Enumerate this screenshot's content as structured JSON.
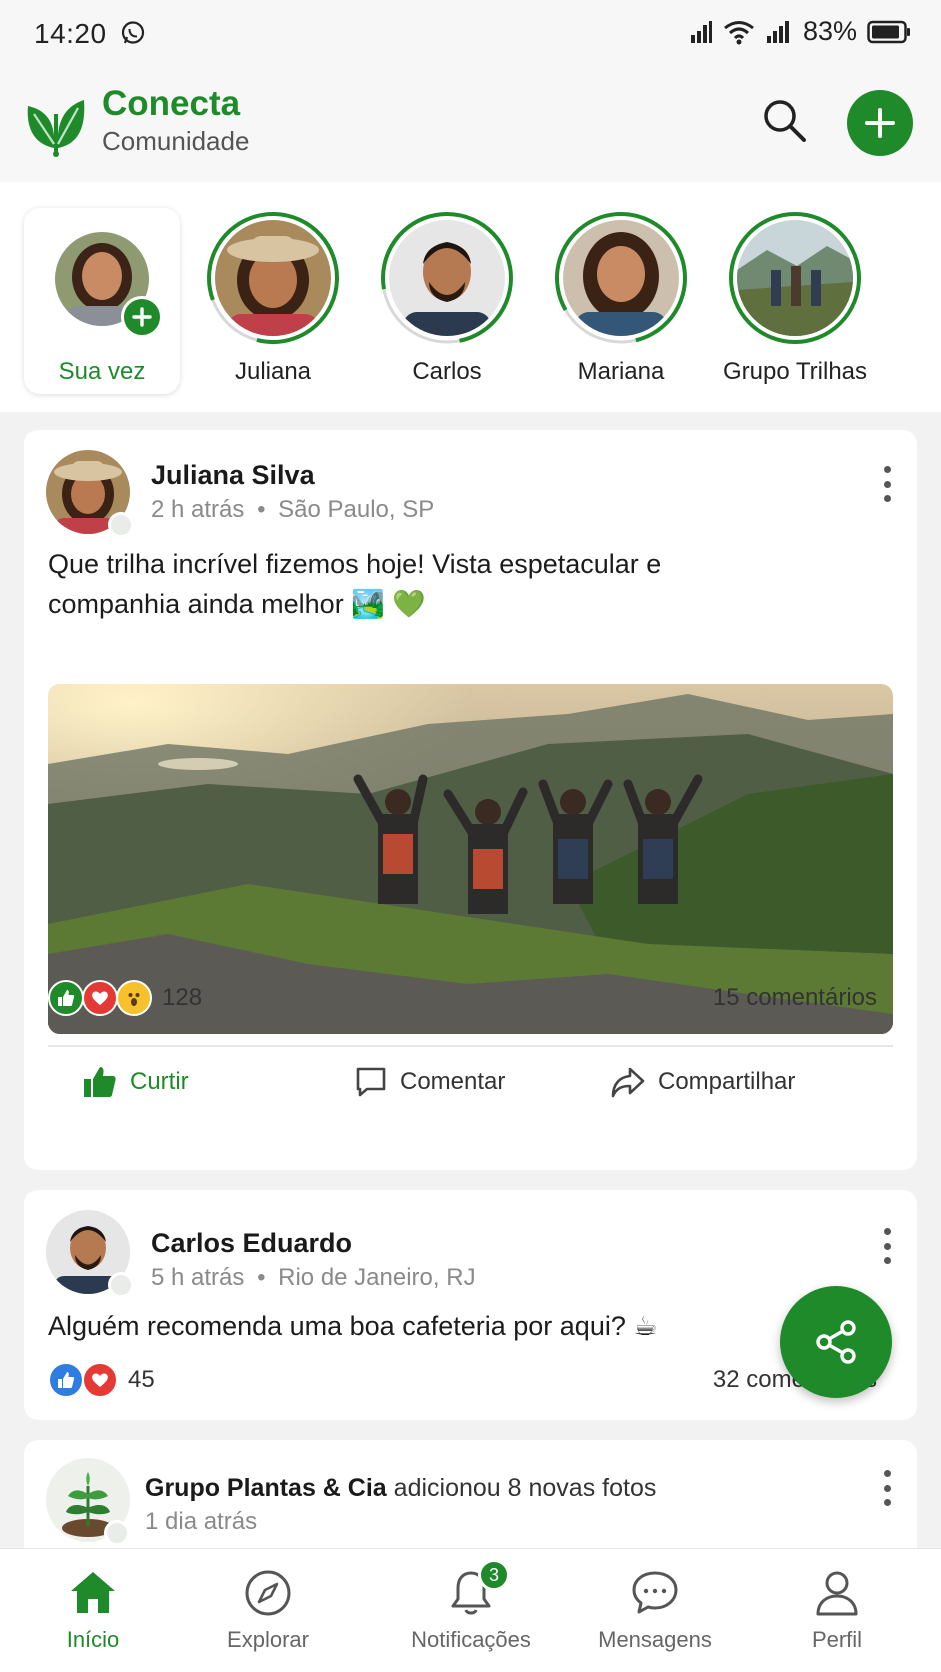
{
  "status_bar": {
    "time": "14:20",
    "battery": "83%"
  },
  "header": {
    "title": "Conecta",
    "subtitle": "Comunidade"
  },
  "stories": [
    {
      "label": "Sua vez"
    },
    {
      "label": "Juliana"
    },
    {
      "label": "Carlos"
    },
    {
      "label": "Mariana"
    },
    {
      "label": "Grupo Trilhas"
    }
  ],
  "posts": [
    {
      "author": "Juliana Silva",
      "time": "2 h atrás",
      "location": "São Paulo, SP",
      "text_line1": "Que trilha incrível fizemos hoje! Vista espetacular e",
      "text_line2": "companhia ainda melhor 🏞️ 💚",
      "reactions_count": "128",
      "comments": "15 comentários",
      "actions": {
        "like": "Curtir",
        "comment": "Comentar",
        "share": "Compartilhar"
      }
    },
    {
      "author": "Carlos Eduardo",
      "time": "5 h atrás",
      "location": "Rio de Janeiro, RJ",
      "text": "Alguém recomenda uma boa cafeteria por aqui? ☕",
      "reactions_count": "45",
      "comments": "32 comentários"
    },
    {
      "author": "Grupo Plantas & Cia",
      "action_text": " adicionou 8 novas fotos",
      "time": "1 dia atrás"
    }
  ],
  "meta_sep": "•",
  "nav": [
    {
      "label": "Início",
      "icon": "home-icon"
    },
    {
      "label": "Explorar",
      "icon": "compass-icon"
    },
    {
      "label": "Notificações",
      "icon": "bell-icon",
      "badge": "3"
    },
    {
      "label": "Mensagens",
      "icon": "chat-icon"
    },
    {
      "label": "Perfil",
      "icon": "user-icon"
    }
  ],
  "colors": {
    "accent": "#1f8a2a",
    "like_blue": "#2f7de1",
    "love_red": "#e53935",
    "wow_yellow": "#f7c12b"
  }
}
